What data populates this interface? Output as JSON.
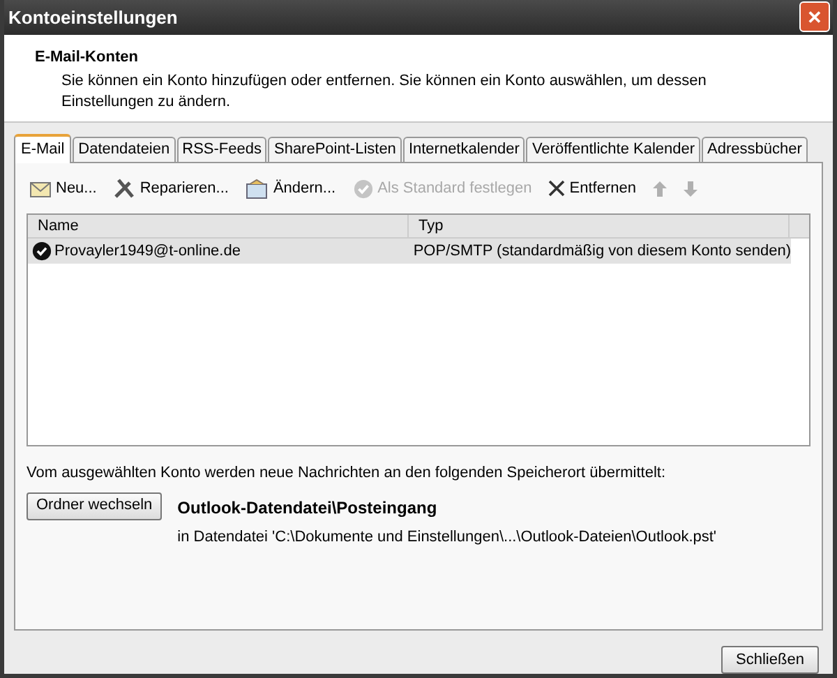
{
  "window": {
    "title": "Kontoeinstellungen",
    "close": "✕"
  },
  "header": {
    "title": "E-Mail-Konten",
    "description": "Sie können ein Konto hinzufügen oder entfernen. Sie können ein Konto auswählen, um dessen Einstellungen zu ändern."
  },
  "tabs": [
    {
      "label": "E-Mail",
      "selected": true
    },
    {
      "label": "Datendateien",
      "selected": false
    },
    {
      "label": "RSS-Feeds",
      "selected": false
    },
    {
      "label": "SharePoint-Listen",
      "selected": false
    },
    {
      "label": "Internetkalender",
      "selected": false
    },
    {
      "label": "Veröffentlichte Kalender",
      "selected": false
    },
    {
      "label": "Adressbücher",
      "selected": false
    }
  ],
  "toolbar": [
    {
      "kind": "new",
      "label": "Neu...",
      "disabled": false
    },
    {
      "kind": "repair",
      "label": "Reparieren...",
      "disabled": false
    },
    {
      "kind": "change",
      "label": "Ändern...",
      "disabled": false
    },
    {
      "kind": "default",
      "label": "Als Standard festlegen",
      "disabled": true
    },
    {
      "kind": "remove",
      "label": "Entfernen",
      "disabled": false
    },
    {
      "kind": "up",
      "disabled": true
    },
    {
      "kind": "down",
      "disabled": true
    }
  ],
  "table": {
    "columns": [
      "Name",
      "Typ"
    ],
    "rows": [
      {
        "name": "Provayler1949@t-online.de",
        "type": "POP/SMTP (standardmäßig von diesem Konto senden)",
        "selected": true,
        "default": true
      }
    ]
  },
  "delivery": {
    "text": "Vom ausgewählten Konto werden neue Nachrichten an den folgenden Speicherort übermittelt:",
    "button": "Ordner wechseln",
    "folder": "Outlook-Datendatei\\Posteingang",
    "path": "in Datendatei 'C:\\Dokumente und Einstellungen\\...\\Outlook-Dateien\\Outlook.pst'"
  },
  "footer": {
    "button": "Schließen"
  }
}
